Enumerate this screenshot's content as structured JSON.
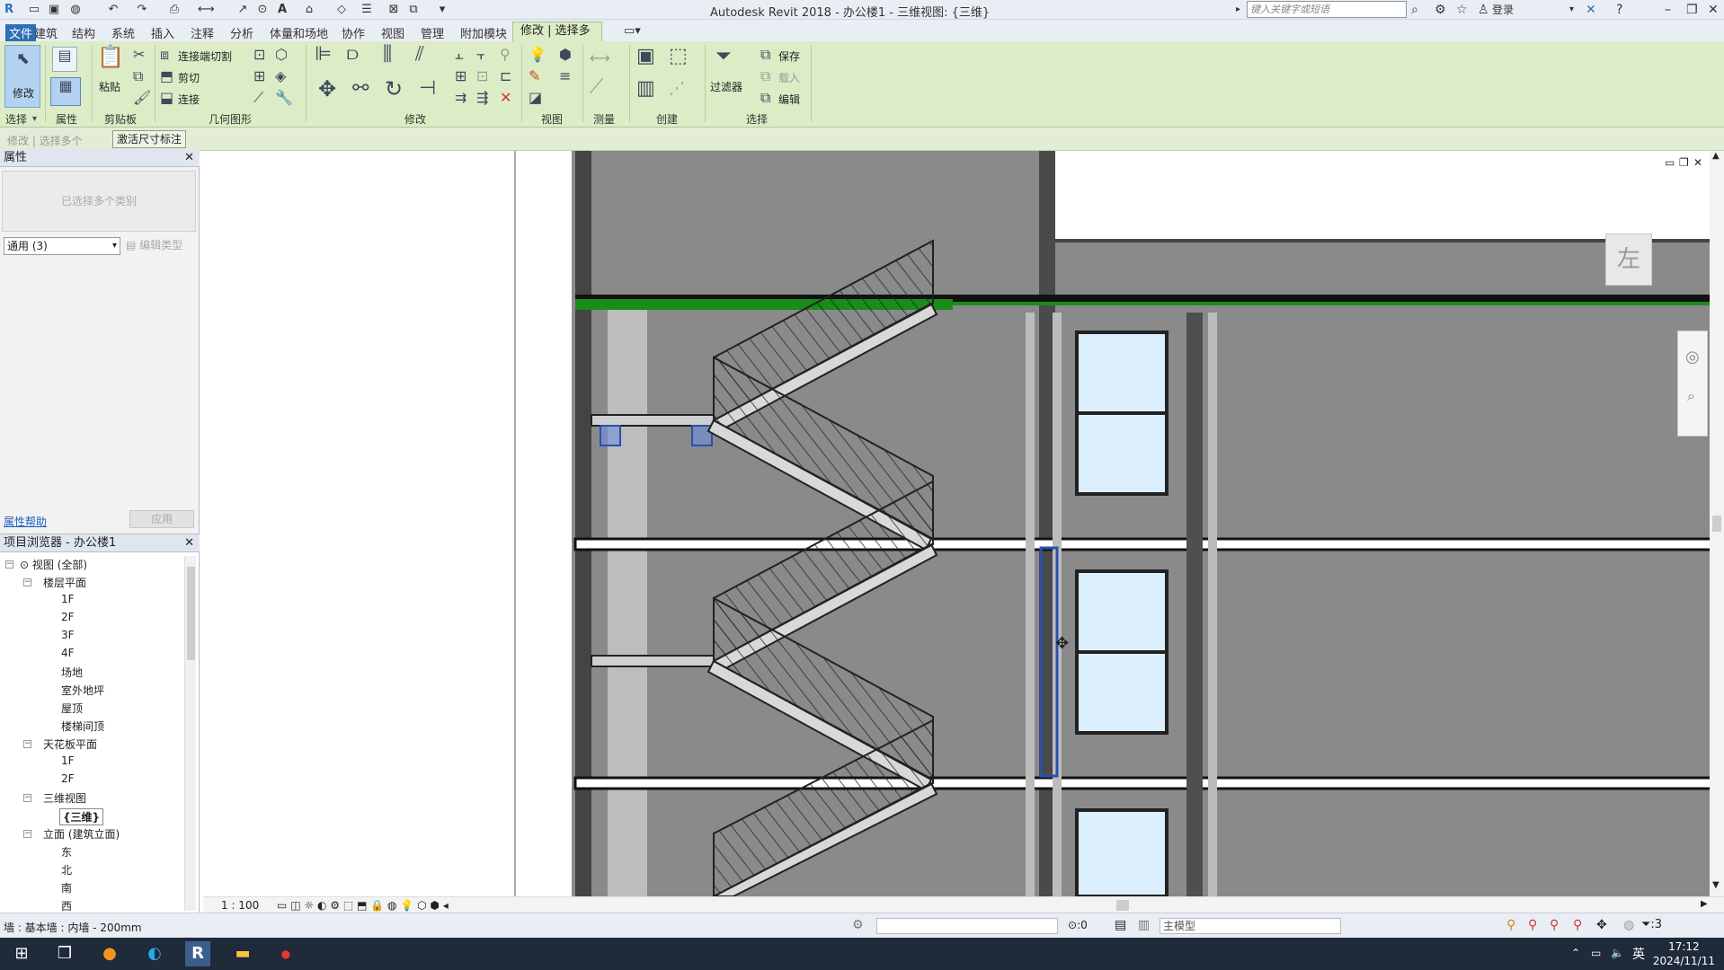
{
  "titlebar": {
    "title": "Autodesk Revit 2018 -    办公楼1 - 三维视图: {三维}",
    "search_placeholder": "键入关键字或短语",
    "login": "登录"
  },
  "menu": {
    "items": [
      "文件",
      "建筑",
      "结构",
      "系统",
      "插入",
      "注释",
      "分析",
      "体量和场地",
      "协作",
      "视图",
      "管理",
      "附加模块"
    ],
    "active_tab": "修改 | 选择多个"
  },
  "ribbon": {
    "modify_label": "修改",
    "paste_label": "粘贴",
    "join_cut_label": "连接端切割",
    "cut_label": "剪切",
    "join_label": "连接",
    "filter_label": "过滤器",
    "save_label": "保存",
    "load_label": "载入",
    "edit_label": "编辑",
    "groups": {
      "select": "选择",
      "properties": "属性",
      "clipboard": "剪贴板",
      "geometry": "几何图形",
      "modify": "修改",
      "view": "视图",
      "measure": "测量",
      "create": "创建",
      "selection": "选择"
    }
  },
  "options": {
    "context": "修改 | 选择多个",
    "activate_dims": "激活尺寸标注"
  },
  "properties": {
    "title": "属性",
    "type_selector": "已选择多个类别",
    "filter_value": "通用 (3)",
    "edit_type": "编辑类型",
    "help_link": "属性帮助",
    "apply": "应用"
  },
  "browser": {
    "title": "项目浏览器 - 办公楼1",
    "root": "视图 (全部)",
    "floor_plans": "楼层平面",
    "floor_items": [
      "1F",
      "2F",
      "3F",
      "4F",
      "场地",
      "室外地坪",
      "屋顶",
      "楼梯间顶"
    ],
    "ceiling_plans": "天花板平面",
    "ceiling_items": [
      "1F",
      "2F"
    ],
    "views_3d": "三维视图",
    "views_3d_items": [
      "{三维}"
    ],
    "elevations": "立面 (建筑立面)",
    "elevation_items": [
      "东",
      "北",
      "南",
      "西"
    ]
  },
  "view": {
    "scale": "1 : 100",
    "viewcube_face": "左"
  },
  "status": {
    "text": "墙 : 基本墙 : 内墙 - 200mm",
    "count_zero": ":0",
    "main_model": "主模型",
    "filter_count": ":3"
  },
  "taskbar": {
    "time": "17:12",
    "date": "2024/11/11",
    "ime": "英"
  }
}
